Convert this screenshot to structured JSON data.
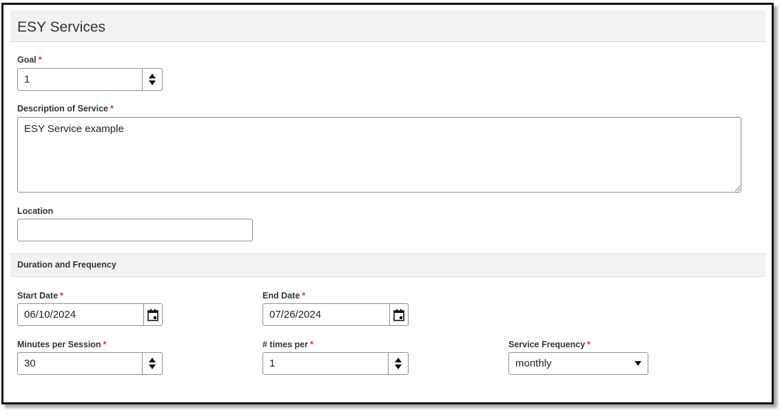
{
  "panel": {
    "title": "ESY Services"
  },
  "required_marker": "*",
  "fields": {
    "goal": {
      "label": "Goal",
      "value": "1"
    },
    "description": {
      "label": "Description of Service",
      "value": "ESY Service example"
    },
    "location": {
      "label": "Location",
      "value": ""
    }
  },
  "section": {
    "title": "Duration and Frequency"
  },
  "duration": {
    "start_date": {
      "label": "Start Date",
      "value": "06/10/2024"
    },
    "end_date": {
      "label": "End Date",
      "value": "07/26/2024"
    },
    "minutes_per_session": {
      "label": "Minutes per Session",
      "value": "30"
    },
    "times_per": {
      "label": "# times per",
      "value": "1"
    },
    "service_frequency": {
      "label": "Service Frequency",
      "value": "monthly"
    }
  },
  "colors": {
    "required": "#c0392b",
    "header_bg": "#f2f2f2"
  },
  "icons": {
    "spinner": "up-down-arrows-icon",
    "calendar": "calendar-icon",
    "dropdown": "chevron-down-icon"
  }
}
